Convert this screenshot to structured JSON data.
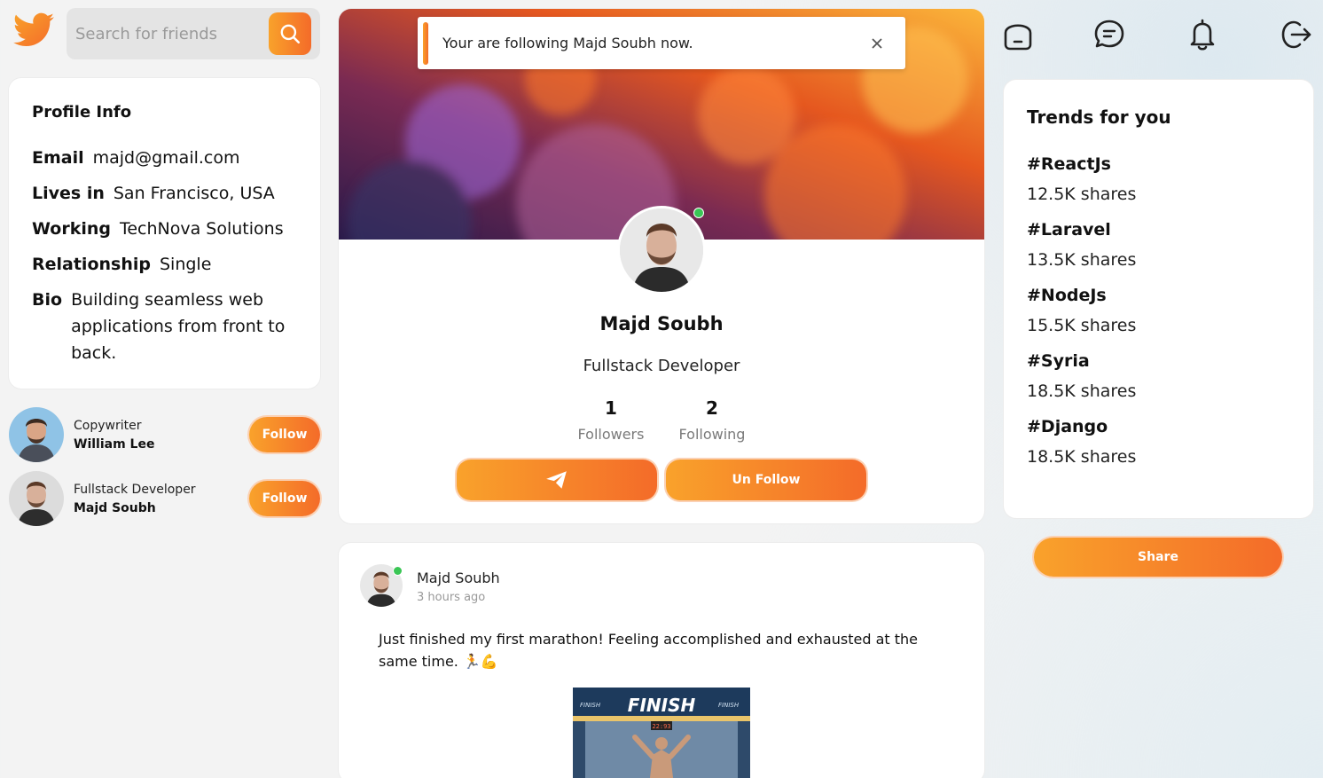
{
  "search": {
    "placeholder": "Search for friends"
  },
  "profile_info": {
    "title": "Profile Info",
    "rows": [
      {
        "key": "Email",
        "value": "majd@gmail.com"
      },
      {
        "key": "Lives in",
        "value": "San Francisco, USA"
      },
      {
        "key": "Working",
        "value": "TechNova Solutions"
      },
      {
        "key": "Relationship",
        "value": "Single"
      },
      {
        "key": "Bio",
        "value": "Building seamless web applications from front to back."
      }
    ]
  },
  "suggestions": [
    {
      "role": "Copywriter",
      "name": "William Lee",
      "button": "Follow"
    },
    {
      "role": "Fullstack Developer",
      "name": "Majd Soubh",
      "button": "Follow"
    }
  ],
  "toast": {
    "message": "Your are following Majd Soubh now."
  },
  "profile": {
    "name": "Majd Soubh",
    "title": "Fullstack Developer",
    "followers_count": "1",
    "followers_label": "Followers",
    "following_count": "2",
    "following_label": "Following",
    "unfollow_label": "Un Follow"
  },
  "post": {
    "author": "Majd Soubh",
    "time": "3 hours ago",
    "text": "Just finished my first marathon! Feeling accomplished and exhausted at the same time. 🏃💪",
    "image_banner": "FINISH",
    "image_banner_small": "FINISH",
    "image_clock": "22:93"
  },
  "trends": {
    "title": "Trends for you",
    "items": [
      {
        "tag": "#ReactJs",
        "shares": "12.5K shares"
      },
      {
        "tag": "#Laravel",
        "shares": "13.5K shares"
      },
      {
        "tag": "#NodeJs",
        "shares": "15.5K shares"
      },
      {
        "tag": "#Syria",
        "shares": "18.5K shares"
      },
      {
        "tag": "#Django",
        "shares": "18.5K shares"
      }
    ]
  },
  "share_label": "Share",
  "colors": {
    "accent_start": "#f9a22b",
    "accent_end": "#f46b29",
    "online": "#3ac655"
  },
  "icons": [
    "twitter-bird-icon",
    "search-icon",
    "home-icon",
    "chat-icon",
    "bell-icon",
    "logout-icon",
    "send-icon",
    "close-icon"
  ]
}
